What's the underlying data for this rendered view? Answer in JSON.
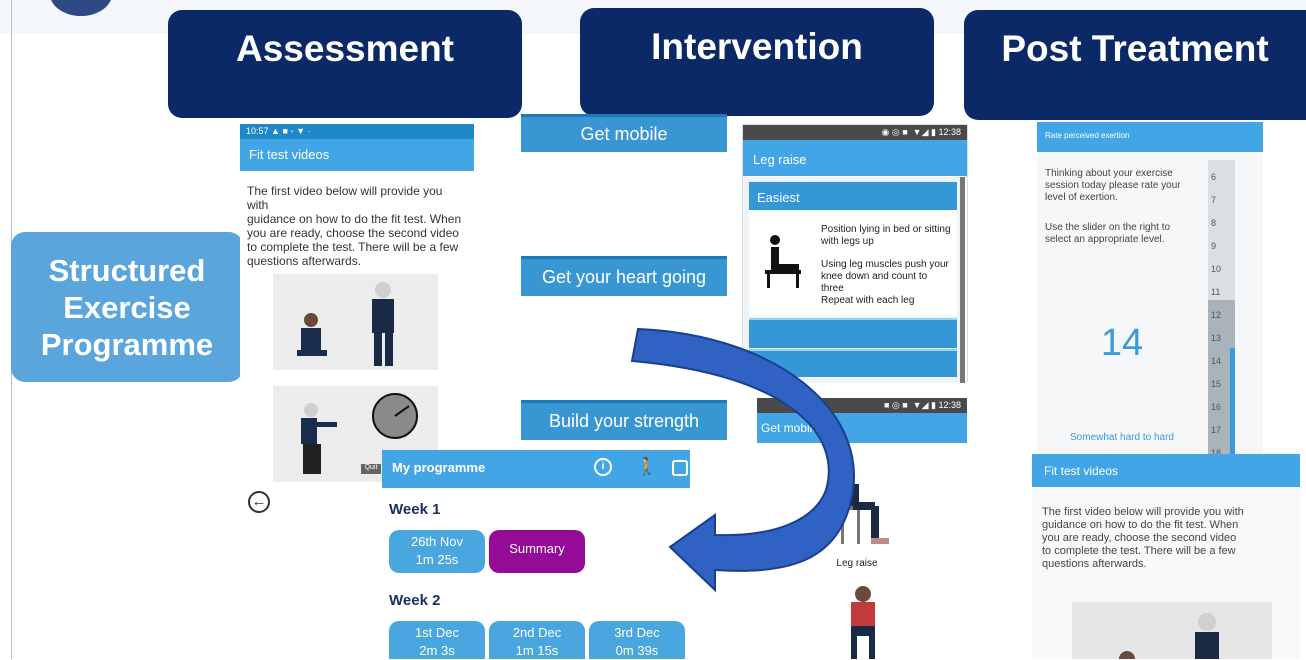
{
  "headers": {
    "assessment": "Assessment",
    "intervention": "Intervention",
    "post": "Post Treatment"
  },
  "side": {
    "line1": "Structured",
    "line2": "Exercise",
    "line3": "Programme"
  },
  "fit_phone": {
    "status": "10:57",
    "title": "Fit test videos",
    "text": [
      "The first video below will provide you with",
      "guidance on how to do the fit test. When",
      "you are ready, choose the second video",
      "to complete the test. There will be a few",
      "questions afterwards."
    ],
    "timer_label": "Quit"
  },
  "intervention": {
    "items": [
      "Get mobile",
      "Get your heart going",
      "Build your strength"
    ]
  },
  "legraise_phone": {
    "status_time": "12:38",
    "title": "Leg raise",
    "level": "Easiest",
    "steps": [
      "Position lying in bed or sitting with legs up",
      "Using leg muscles push your knee down and count to three",
      "Repeat with each leg"
    ]
  },
  "getmobile_phone": {
    "status_time": "12:38",
    "title": "Get mobile",
    "caption": "Leg raise"
  },
  "programme": {
    "title": "My programme",
    "weeks": [
      {
        "label": "Week 1",
        "sessions": [
          {
            "date": "26th Nov",
            "dur": "1m 25s"
          }
        ],
        "summary": "Summary"
      },
      {
        "label": "Week 2",
        "sessions": [
          {
            "date": "1st Dec",
            "dur": "2m 3s"
          },
          {
            "date": "2nd Dec",
            "dur": "1m 15s"
          },
          {
            "date": "3rd Dec",
            "dur": "0m 39s"
          }
        ]
      }
    ]
  },
  "rpe": {
    "title": "Rate perceived exertion",
    "text1": [
      "Thinking about your exercise",
      "session today please rate your",
      "level of exertion."
    ],
    "text2": [
      "Use the slider on the right to",
      "select an appropriate level."
    ],
    "value": "14",
    "scale": [
      "6",
      "7",
      "8",
      "9",
      "10",
      "11",
      "12",
      "13",
      "14",
      "15",
      "16",
      "17",
      "18"
    ],
    "descriptor": "Somewhat hard to hard"
  },
  "fit2": {
    "title": "Fit test videos",
    "text": [
      "The first video below will provide you with",
      "guidance on how to do the fit test. When",
      "you are ready, choose the second video",
      "to complete the test. There will be a few",
      "questions afterwards."
    ]
  }
}
